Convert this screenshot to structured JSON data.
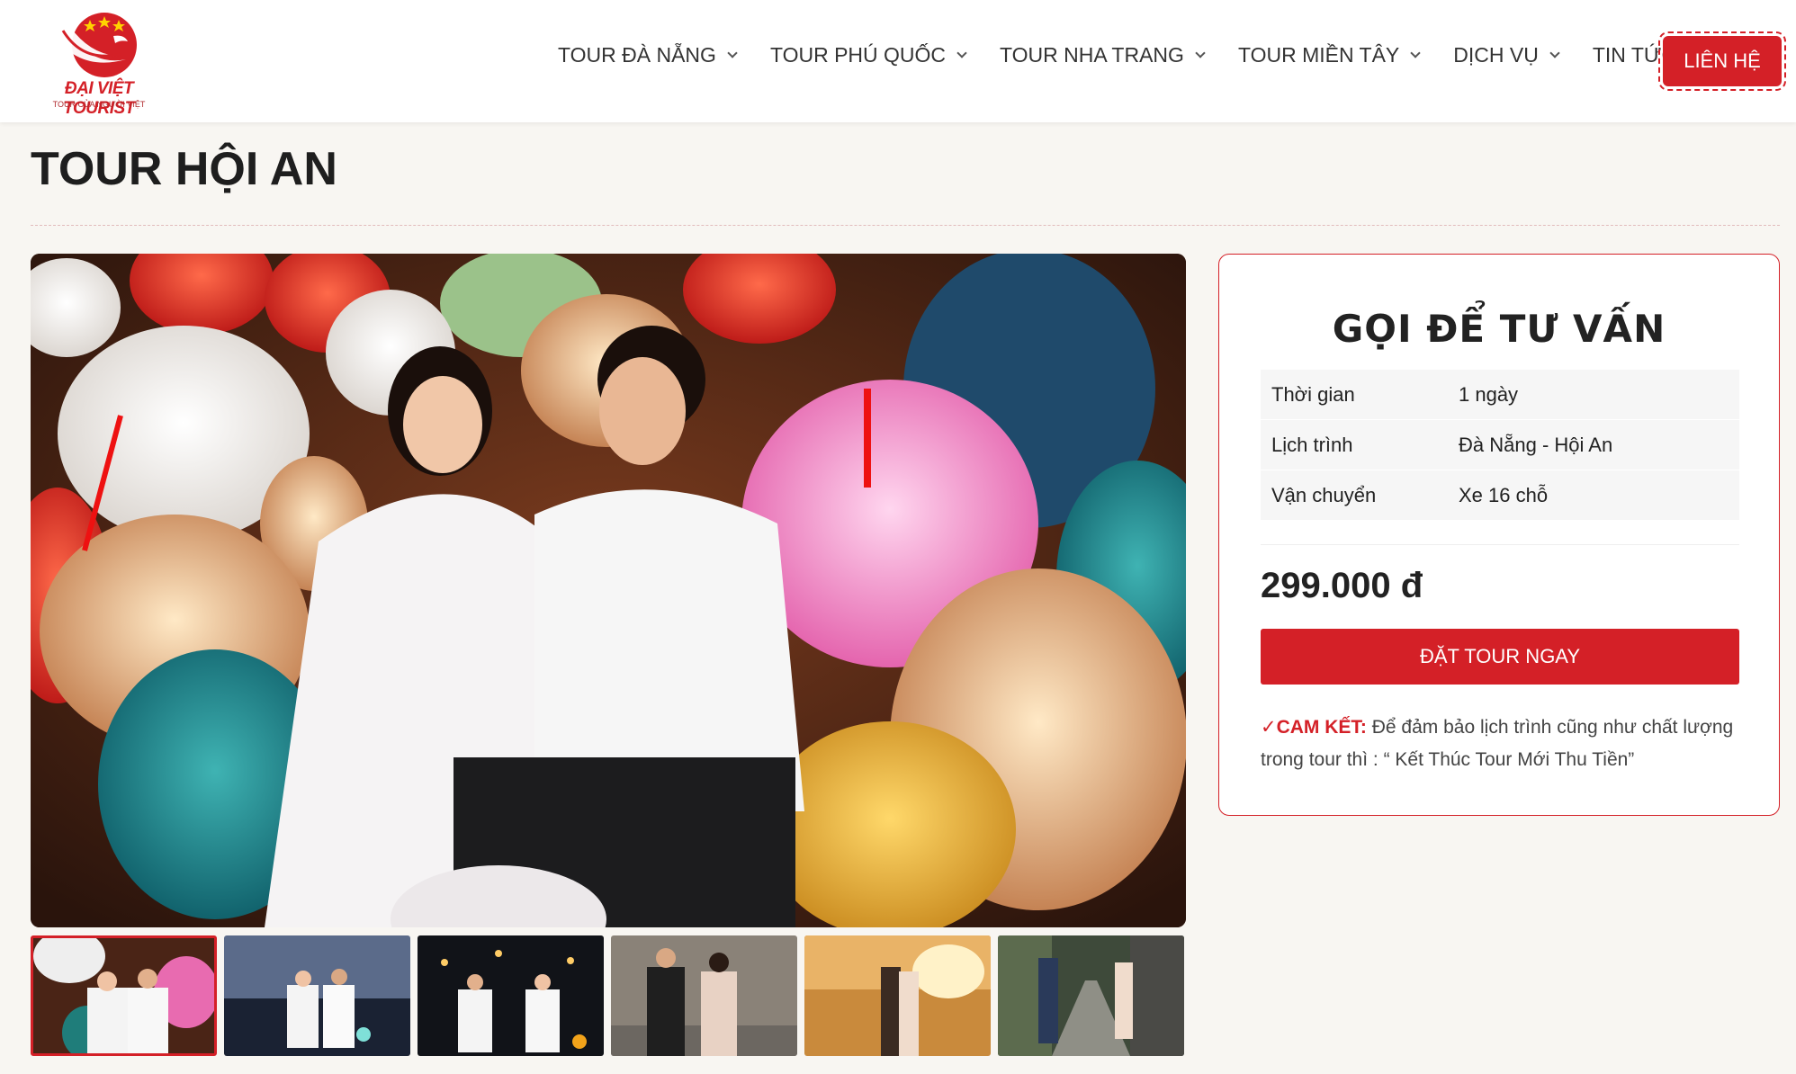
{
  "header": {
    "logo": {
      "brand": "ĐẠI VIỆT TOURIST",
      "tagline": "TOUR CỦA NGƯỜI VIỆT"
    },
    "nav": [
      {
        "label": "TOUR ĐÀ NẴNG"
      },
      {
        "label": "TOUR PHÚ QUỐC"
      },
      {
        "label": "TOUR NHA TRANG"
      },
      {
        "label": "TOUR MIỀN TÂY"
      },
      {
        "label": "DỊCH VỤ"
      },
      {
        "label": "TIN TỨC"
      }
    ],
    "contact_label": "LIÊN HỆ"
  },
  "page_title": "TOUR HỘI AN",
  "booking": {
    "title": "GỌI ĐỂ TƯ VẤN",
    "info": [
      {
        "key": "Thời gian",
        "value": "1 ngày"
      },
      {
        "key": "Lịch trình",
        "value": "Đà Nẵng - Hội An"
      },
      {
        "key": "Vận chuyển",
        "value": "Xe 16 chỗ"
      }
    ],
    "price": "299.000 đ",
    "book_label": "ĐẶT TOUR NGAY",
    "commit_label": "✓CAM KẾT:",
    "commit_text": " Để đảm bảo lịch trình cũng như chất lượng trong tour thì : “ Kết Thúc Tour Mới Thu Tiền”"
  },
  "colors": {
    "brand_red": "#d42027"
  },
  "gallery": {
    "thumb_count": 6,
    "active_index": 0
  }
}
